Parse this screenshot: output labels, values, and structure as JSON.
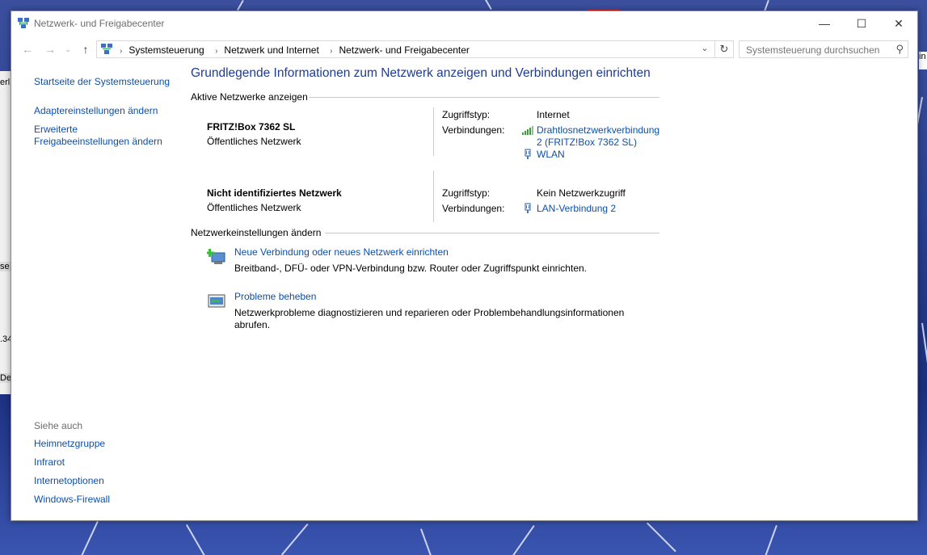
{
  "window": {
    "title": "Netzwerk- und Freigabecenter",
    "controls": {
      "minimize": "—",
      "maximize": "☐",
      "close": "✕"
    }
  },
  "address": {
    "crumbs": [
      "Systemsteuerung",
      "Netzwerk und Internet",
      "Netzwerk- und Freigabecenter"
    ],
    "search_placeholder": "Systemsteuerung durchsuchen"
  },
  "leftnav": {
    "home": "Startseite der Systemsteuerung",
    "adapter": "Adaptereinstellungen ändern",
    "sharing_line1": "Erweiterte",
    "sharing_line2": "Freigabeeinstellungen ändern"
  },
  "see_also": {
    "header": "Siehe auch",
    "items": [
      "Heimnetzgruppe",
      "Infrarot",
      "Internetoptionen",
      "Windows-Firewall"
    ]
  },
  "main": {
    "heading": "Grundlegende Informationen zum Netzwerk anzeigen und Verbindungen einrichten",
    "active_header": "Aktive Netzwerke anzeigen",
    "networks": [
      {
        "name": "FRITZ!Box 7362 SL",
        "type": "Öffentliches Netzwerk",
        "access_label": "Zugriffstyp:",
        "access_value": "Internet",
        "conn_label": "Verbindungen:",
        "conn1_line1": "Drahtlosnetzwerkverbindung",
        "conn1_line2": "2 (FRITZ!Box 7362 SL)",
        "conn2": "WLAN"
      },
      {
        "name": "Nicht identifiziertes Netzwerk",
        "type": "Öffentliches Netzwerk",
        "access_label": "Zugriffstyp:",
        "access_value": "Kein Netzwerkzugriff",
        "conn_label": "Verbindungen:",
        "conn1": "LAN-Verbindung 2"
      }
    ],
    "settings_header": "Netzwerkeinstellungen ändern",
    "tasks": [
      {
        "link": "Neue Verbindung oder neues Netzwerk einrichten",
        "desc": "Breitband-, DFÜ- oder VPN-Verbindung bzw. Router oder Zugriffspunkt einrichten."
      },
      {
        "link": "Probleme beheben",
        "desc_line1": "Netzwerkprobleme diagnostizieren und reparieren oder Problembehandlungsinformationen",
        "desc_line2": "abrufen."
      }
    ]
  },
  "colors": {
    "link": "#0b4fad",
    "heading": "#1e3c94",
    "muted": "#6d6d6d"
  },
  "background_window_fragments": [
    "erl",
    "se",
    ".34",
    "De"
  ],
  "background_right_fragment": "in"
}
